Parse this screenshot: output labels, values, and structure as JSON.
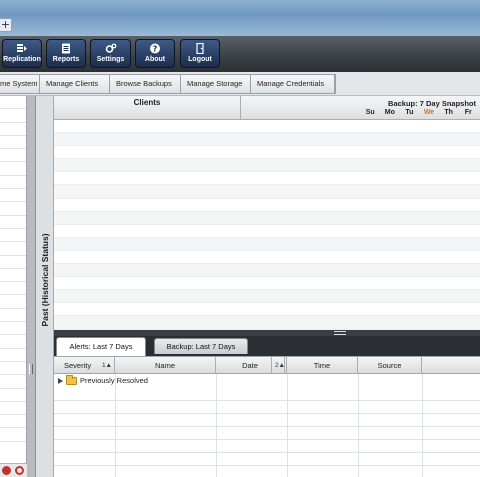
{
  "browser": {
    "new_tab_label": "+"
  },
  "toolbar": {
    "buttons": [
      {
        "label": "Replication",
        "icon": "replication-icon"
      },
      {
        "label": "Reports",
        "icon": "reports-icon"
      },
      {
        "label": "Settings",
        "icon": "gear-icon"
      },
      {
        "label": "About",
        "icon": "question-icon"
      },
      {
        "label": "Logout",
        "icon": "logout-icon"
      }
    ]
  },
  "subnav": {
    "tabs": [
      {
        "label": "me System"
      },
      {
        "label": "Manage Clients"
      },
      {
        "label": "Browse Backups"
      },
      {
        "label": "Manage Storage"
      },
      {
        "label": "Manage Credentials"
      }
    ]
  },
  "panel": {
    "vertical_title": "Past (Historical Status)"
  },
  "clients_table": {
    "header": "Clients",
    "snapshot_title": "Backup: 7 Day Snapshot",
    "days": [
      "Su",
      "Mo",
      "Tu",
      "We",
      "Th",
      "Fr"
    ],
    "today_index": 3
  },
  "alerts": {
    "tabs": [
      {
        "label": "Alerts: Last 7 Days"
      },
      {
        "label": "Backup: Last 7 Days"
      }
    ],
    "columns": [
      {
        "label": "Severity",
        "sort": "1▲"
      },
      {
        "label": "Name",
        "sort": ""
      },
      {
        "label": "Date",
        "sort": "2▲"
      },
      {
        "label": "Time",
        "sort": ""
      },
      {
        "label": "Source",
        "sort": ""
      }
    ],
    "group_label": "Previously Resolved"
  },
  "colors": {
    "accent_today": "#d0781a",
    "toolbar_button": "#1c2d4d"
  }
}
